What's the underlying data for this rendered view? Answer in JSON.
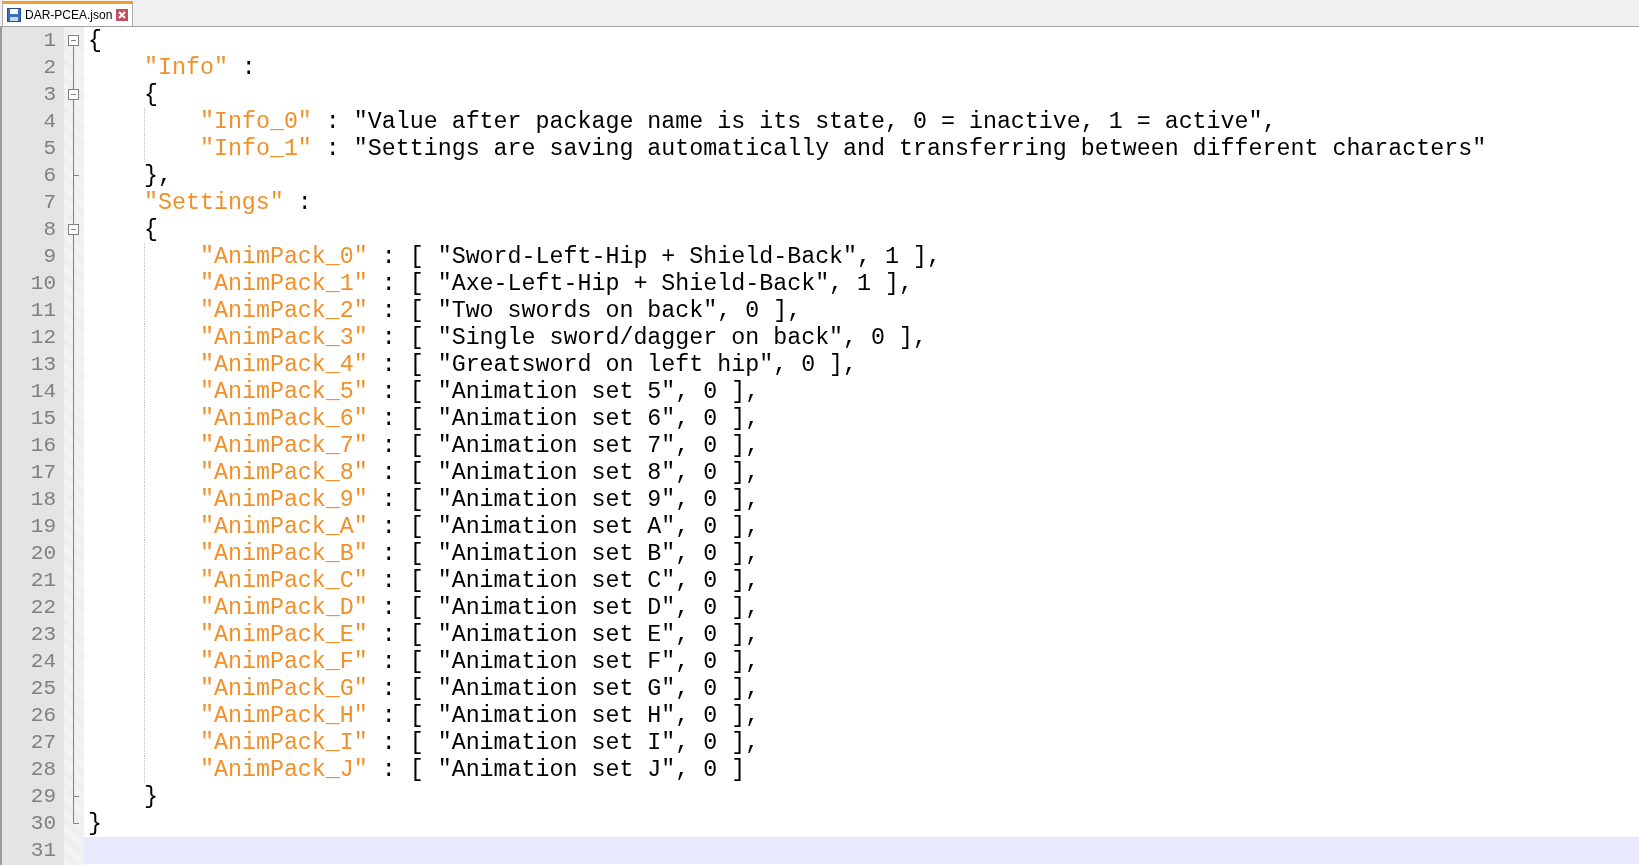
{
  "tab": {
    "title": "DAR-PCEA.json",
    "selected": true
  },
  "lines": [
    {
      "number": "1",
      "fold_start": true,
      "fold_end": false,
      "current": false,
      "tokens": [
        {
          "kind": "plain",
          "text": "{"
        }
      ]
    },
    {
      "number": "2",
      "fold_start": false,
      "fold_end": false,
      "current": false,
      "tokens": [
        {
          "kind": "key",
          "text": "\"Info\""
        },
        {
          "kind": "plain",
          "text": " :"
        }
      ]
    },
    {
      "number": "3",
      "fold_start": true,
      "fold_end": false,
      "current": false,
      "tokens": [
        {
          "kind": "plain",
          "text": "{"
        }
      ]
    },
    {
      "number": "4",
      "fold_start": false,
      "fold_end": false,
      "current": false,
      "tokens": [
        {
          "kind": "key",
          "text": "\"Info_0\""
        },
        {
          "kind": "plain",
          "text": " : \"Value after package name is its state, 0 = inactive, 1 = active\","
        }
      ]
    },
    {
      "number": "5",
      "fold_start": false,
      "fold_end": false,
      "current": false,
      "tokens": [
        {
          "kind": "key",
          "text": "\"Info_1\""
        },
        {
          "kind": "plain",
          "text": " : \"Settings are saving automatically and transferring between different characters\""
        }
      ]
    },
    {
      "number": "6",
      "fold_start": false,
      "fold_end": true,
      "current": false,
      "tokens": [
        {
          "kind": "plain",
          "text": "},"
        }
      ]
    },
    {
      "number": "7",
      "fold_start": false,
      "fold_end": false,
      "current": false,
      "tokens": [
        {
          "kind": "key",
          "text": "\"Settings\""
        },
        {
          "kind": "plain",
          "text": " :"
        }
      ]
    },
    {
      "number": "8",
      "fold_start": true,
      "fold_end": false,
      "current": false,
      "tokens": [
        {
          "kind": "plain",
          "text": "{"
        }
      ]
    },
    {
      "number": "9",
      "fold_start": false,
      "fold_end": false,
      "current": false,
      "tokens": [
        {
          "kind": "key",
          "text": "\"AnimPack_0\""
        },
        {
          "kind": "plain",
          "text": " : [ \"Sword-Left-Hip + Shield-Back\", 1 ],"
        }
      ]
    },
    {
      "number": "10",
      "fold_start": false,
      "fold_end": false,
      "current": false,
      "tokens": [
        {
          "kind": "key",
          "text": "\"AnimPack_1\""
        },
        {
          "kind": "plain",
          "text": " : [ \"Axe-Left-Hip + Shield-Back\", 1 ],"
        }
      ]
    },
    {
      "number": "11",
      "fold_start": false,
      "fold_end": false,
      "current": false,
      "tokens": [
        {
          "kind": "key",
          "text": "\"AnimPack_2\""
        },
        {
          "kind": "plain",
          "text": " : [ \"Two swords on back\", 0 ],"
        }
      ]
    },
    {
      "number": "12",
      "fold_start": false,
      "fold_end": false,
      "current": false,
      "tokens": [
        {
          "kind": "key",
          "text": "\"AnimPack_3\""
        },
        {
          "kind": "plain",
          "text": " : [ \"Single sword/dagger on back\", 0 ],"
        }
      ]
    },
    {
      "number": "13",
      "fold_start": false,
      "fold_end": false,
      "current": false,
      "tokens": [
        {
          "kind": "key",
          "text": "\"AnimPack_4\""
        },
        {
          "kind": "plain",
          "text": " : [ \"Greatsword on left hip\", 0 ],"
        }
      ]
    },
    {
      "number": "14",
      "fold_start": false,
      "fold_end": false,
      "current": false,
      "tokens": [
        {
          "kind": "key",
          "text": "\"AnimPack_5\""
        },
        {
          "kind": "plain",
          "text": " : [ \"Animation set 5\", 0 ],"
        }
      ]
    },
    {
      "number": "15",
      "fold_start": false,
      "fold_end": false,
      "current": false,
      "tokens": [
        {
          "kind": "key",
          "text": "\"AnimPack_6\""
        },
        {
          "kind": "plain",
          "text": " : [ \"Animation set 6\", 0 ],"
        }
      ]
    },
    {
      "number": "16",
      "fold_start": false,
      "fold_end": false,
      "current": false,
      "tokens": [
        {
          "kind": "key",
          "text": "\"AnimPack_7\""
        },
        {
          "kind": "plain",
          "text": " : [ \"Animation set 7\", 0 ],"
        }
      ]
    },
    {
      "number": "17",
      "fold_start": false,
      "fold_end": false,
      "current": false,
      "tokens": [
        {
          "kind": "key",
          "text": "\"AnimPack_8\""
        },
        {
          "kind": "plain",
          "text": " : [ \"Animation set 8\", 0 ],"
        }
      ]
    },
    {
      "number": "18",
      "fold_start": false,
      "fold_end": false,
      "current": false,
      "tokens": [
        {
          "kind": "key",
          "text": "\"AnimPack_9\""
        },
        {
          "kind": "plain",
          "text": " : [ \"Animation set 9\", 0 ],"
        }
      ]
    },
    {
      "number": "19",
      "fold_start": false,
      "fold_end": false,
      "current": false,
      "tokens": [
        {
          "kind": "key",
          "text": "\"AnimPack_A\""
        },
        {
          "kind": "plain",
          "text": " : [ \"Animation set A\", 0 ],"
        }
      ]
    },
    {
      "number": "20",
      "fold_start": false,
      "fold_end": false,
      "current": false,
      "tokens": [
        {
          "kind": "key",
          "text": "\"AnimPack_B\""
        },
        {
          "kind": "plain",
          "text": " : [ \"Animation set B\", 0 ],"
        }
      ]
    },
    {
      "number": "21",
      "fold_start": false,
      "fold_end": false,
      "current": false,
      "tokens": [
        {
          "kind": "key",
          "text": "\"AnimPack_C\""
        },
        {
          "kind": "plain",
          "text": " : [ \"Animation set C\", 0 ],"
        }
      ]
    },
    {
      "number": "22",
      "fold_start": false,
      "fold_end": false,
      "current": false,
      "tokens": [
        {
          "kind": "key",
          "text": "\"AnimPack_D\""
        },
        {
          "kind": "plain",
          "text": " : [ \"Animation set D\", 0 ],"
        }
      ]
    },
    {
      "number": "23",
      "fold_start": false,
      "fold_end": false,
      "current": false,
      "tokens": [
        {
          "kind": "key",
          "text": "\"AnimPack_E\""
        },
        {
          "kind": "plain",
          "text": " : [ \"Animation set E\", 0 ],"
        }
      ]
    },
    {
      "number": "24",
      "fold_start": false,
      "fold_end": false,
      "current": false,
      "tokens": [
        {
          "kind": "key",
          "text": "\"AnimPack_F\""
        },
        {
          "kind": "plain",
          "text": " : [ \"Animation set F\", 0 ],"
        }
      ]
    },
    {
      "number": "25",
      "fold_start": false,
      "fold_end": false,
      "current": false,
      "tokens": [
        {
          "kind": "key",
          "text": "\"AnimPack_G\""
        },
        {
          "kind": "plain",
          "text": " : [ \"Animation set G\", 0 ],"
        }
      ]
    },
    {
      "number": "26",
      "fold_start": false,
      "fold_end": false,
      "current": false,
      "tokens": [
        {
          "kind": "key",
          "text": "\"AnimPack_H\""
        },
        {
          "kind": "plain",
          "text": " : [ \"Animation set H\", 0 ],"
        }
      ]
    },
    {
      "number": "27",
      "fold_start": false,
      "fold_end": false,
      "current": false,
      "tokens": [
        {
          "kind": "key",
          "text": "\"AnimPack_I\""
        },
        {
          "kind": "plain",
          "text": " : [ \"Animation set I\", 0 ],"
        }
      ]
    },
    {
      "number": "28",
      "fold_start": false,
      "fold_end": false,
      "current": false,
      "tokens": [
        {
          "kind": "key",
          "text": "\"AnimPack_J\""
        },
        {
          "kind": "plain",
          "text": " : [ \"Animation set J\", 0 ]"
        }
      ]
    },
    {
      "number": "29",
      "fold_start": false,
      "fold_end": true,
      "current": false,
      "tokens": [
        {
          "kind": "plain",
          "text": "}"
        }
      ]
    },
    {
      "number": "30",
      "fold_start": false,
      "fold_end": true,
      "current": false,
      "tokens": [
        {
          "kind": "plain",
          "text": "}"
        }
      ]
    },
    {
      "number": "31",
      "fold_start": false,
      "fold_end": false,
      "current": true
    }
  ]
}
